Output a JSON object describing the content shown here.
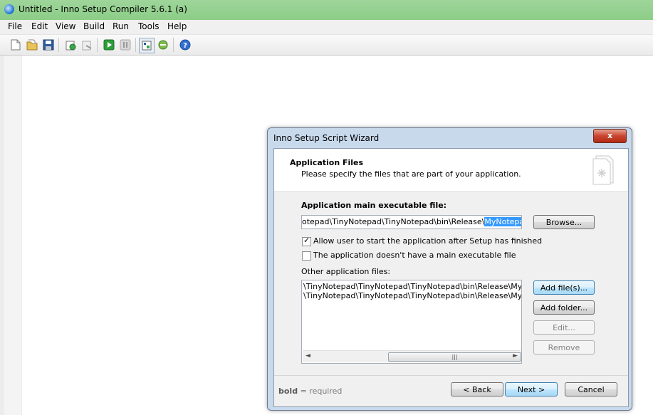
{
  "window": {
    "title": "Untitled - Inno Setup Compiler 5.6.1 (a)"
  },
  "menu": [
    "File",
    "Edit",
    "View",
    "Build",
    "Run",
    "Tools",
    "Help"
  ],
  "toolbar": {
    "icons": [
      "new-file-icon",
      "open-folder-icon",
      "save-icon",
      "compile-icon",
      "stop-compile-icon",
      "run-icon",
      "pause-icon",
      "target-setup-icon",
      "target-uninstall-icon",
      "help-icon"
    ]
  },
  "dialog": {
    "title": "Inno Setup Script Wizard",
    "close_label": "x",
    "header_title": "Application Files",
    "header_subtitle": "Please specify the files that are part of your application.",
    "main_exe_label": "Application main executable file:",
    "main_exe_path_prefix": "otepad\\TinyNotepad\\TinyNotepad\\bin\\Release\\",
    "main_exe_path_selected": "MyNotepad.exe",
    "browse_label": "Browse...",
    "allow_start_label": "Allow user to start the application after Setup has finished",
    "allow_start_checked": true,
    "no_main_exe_label": "The application doesn't have a main executable file",
    "no_main_exe_checked": false,
    "other_files_label": "Other application files:",
    "other_files": [
      "\\TinyNotepad\\TinyNotepad\\TinyNotepad\\bin\\Release\\MyNotepad.exe.config",
      "\\TinyNotepad\\TinyNotepad\\TinyNotepad\\bin\\Release\\MyNotepad.pdb"
    ],
    "add_files_label": "Add file(s)...",
    "add_folder_label": "Add folder...",
    "edit_label": "Edit...",
    "remove_label": "Remove",
    "footer_bold": "bold",
    "footer_text": " = required",
    "back_label": "< Back",
    "next_label": "Next >",
    "cancel_label": "Cancel"
  }
}
